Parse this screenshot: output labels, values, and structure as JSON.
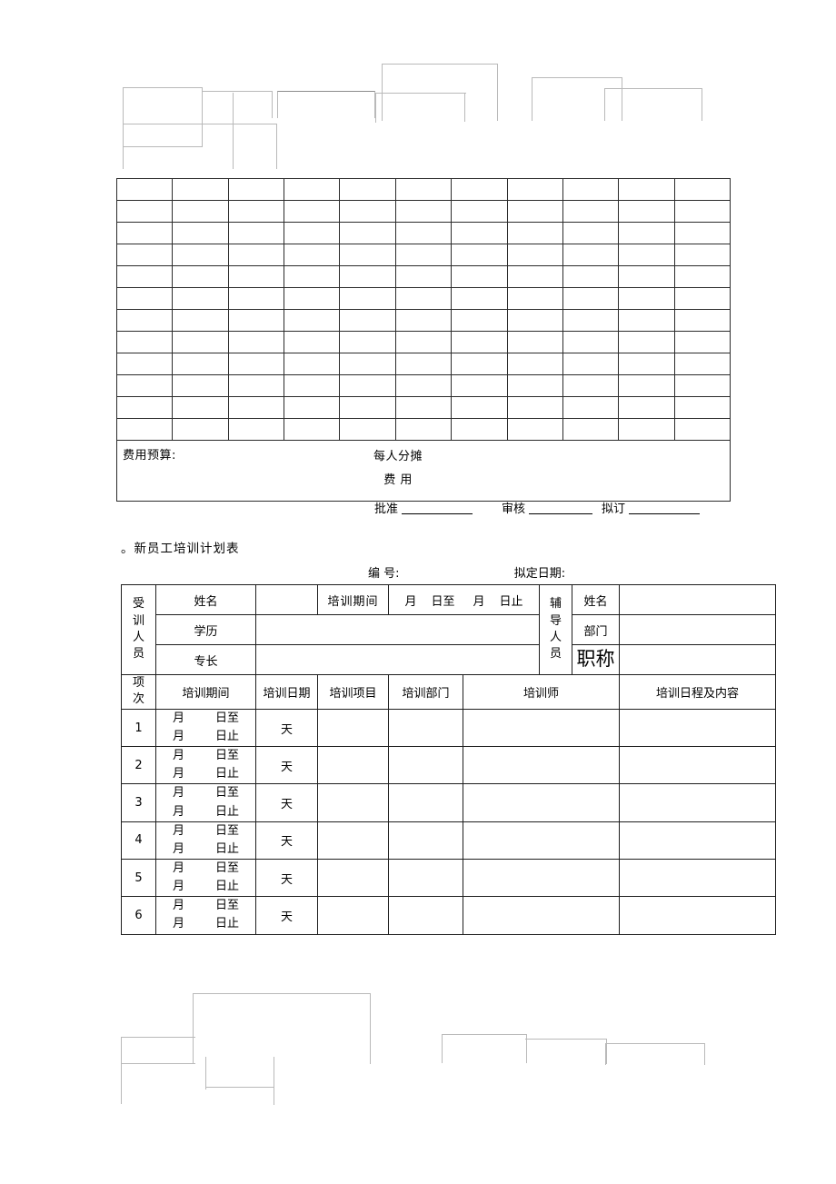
{
  "document": {
    "title": "。新员工培训计划表",
    "meta": {
      "number_label": "编    号:",
      "date_label": "拟定日期:"
    }
  },
  "budget_table": {
    "columns": 11,
    "rows": 12,
    "budget_label": "费用预算:",
    "per_person_label": "每人分摊",
    "per_person_fee": "费      用"
  },
  "approval": {
    "approve_label": "批准",
    "review_label": "审核",
    "draft_label": "拟订"
  },
  "plan_table": {
    "trainee_group_label": {
      "chars": [
        "受",
        "训",
        "人",
        "员"
      ]
    },
    "mentor_group_label": {
      "chars": [
        "辅",
        "导",
        "人",
        "员"
      ]
    },
    "trainee_fields": [
      "姓名",
      "学历",
      "专长"
    ],
    "mentor_fields": [
      "姓名",
      "部门",
      "职称"
    ],
    "period_label": "培训期间",
    "period_range": {
      "month1": "月",
      "day1": "日至",
      "month2": "月",
      "day2": "日止"
    },
    "index_header": {
      "chars": [
        "项",
        "次"
      ]
    },
    "headers": [
      "培训期间",
      "培训日期",
      "培训项目",
      "培训部门",
      "培训师",
      "培训日程及内容"
    ],
    "row_range": {
      "line1": {
        "month": "月",
        "day": "日至"
      },
      "line2": {
        "month": "月",
        "day": "日止"
      }
    },
    "days_unit": "天",
    "rows": [
      {
        "index": "1"
      },
      {
        "index": "2"
      },
      {
        "index": "3"
      },
      {
        "index": "4"
      },
      {
        "index": "5"
      },
      {
        "index": "6"
      }
    ]
  },
  "colors": {
    "border_dark": "#1e1e1e",
    "border_faint": "#b9b9b9",
    "text": "#000000",
    "background": "#ffffff"
  }
}
